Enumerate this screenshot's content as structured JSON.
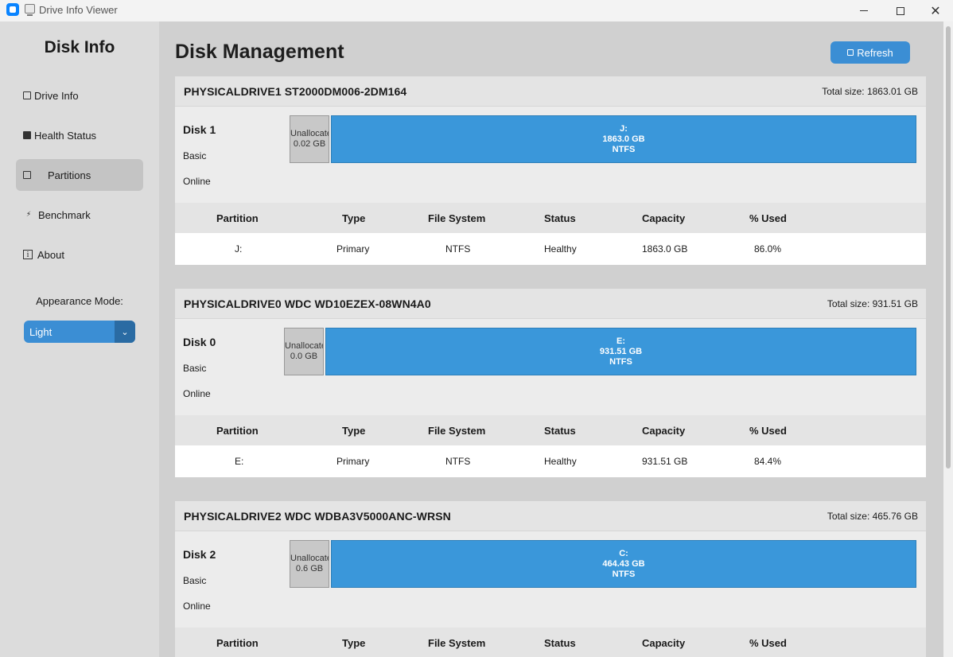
{
  "window": {
    "title": "Drive Info Viewer",
    "close_glyph": "✕"
  },
  "sidebar": {
    "brand": "Disk Info",
    "items": [
      {
        "label": "Drive Info",
        "icon": "drive-icon"
      },
      {
        "label": "Health Status",
        "icon": "health-icon"
      },
      {
        "label": "Partitions",
        "icon": "partitions-icon",
        "active": true
      },
      {
        "label": "Benchmark",
        "icon": "lightning-icon"
      },
      {
        "label": "About",
        "icon": "info-icon"
      }
    ],
    "appearance_label": "Appearance Mode:",
    "appearance_value": "Light"
  },
  "main": {
    "title": "Disk Management",
    "refresh_label": "Refresh",
    "table_headers": [
      "Partition",
      "Type",
      "File System",
      "Status",
      "Capacity",
      "% Used"
    ],
    "disks": [
      {
        "drive": "PHYSICALDRIVE1 ST2000DM006-2DM164",
        "total": "Total size: 1863.01 GB",
        "label": "Disk 1",
        "kind": "Basic",
        "state": "Online",
        "unalloc_label": "Unallocated",
        "unalloc_size": "0.02 GB",
        "part_letter": "J:",
        "part_size": "1863.0 GB",
        "part_fs": "NTFS",
        "row": [
          "J:",
          "Primary",
          "NTFS",
          "Healthy",
          "1863.0 GB",
          "86.0%"
        ]
      },
      {
        "drive": "PHYSICALDRIVE0 WDC WD10EZEX-08WN4A0",
        "total": "Total size: 931.51 GB",
        "label": "Disk 0",
        "kind": "Basic",
        "state": "Online",
        "unalloc_label": "Unallocated",
        "unalloc_size": "0.0 GB",
        "part_letter": "E:",
        "part_size": "931.51 GB",
        "part_fs": "NTFS",
        "row": [
          "E:",
          "Primary",
          "NTFS",
          "Healthy",
          "931.51 GB",
          "84.4%"
        ]
      },
      {
        "drive": "PHYSICALDRIVE2 WDC WDBA3V5000ANC-WRSN",
        "total": "Total size: 465.76 GB",
        "label": "Disk 2",
        "kind": "Basic",
        "state": "Online",
        "unalloc_label": "Unallocated",
        "unalloc_size": "0.6 GB",
        "part_letter": "C:",
        "part_size": "464.43 GB",
        "part_fs": "NTFS"
      }
    ]
  },
  "colors": {
    "accent": "#3b8ed4",
    "partition": "#3a97da",
    "unallocated": "#c8c8c8"
  }
}
